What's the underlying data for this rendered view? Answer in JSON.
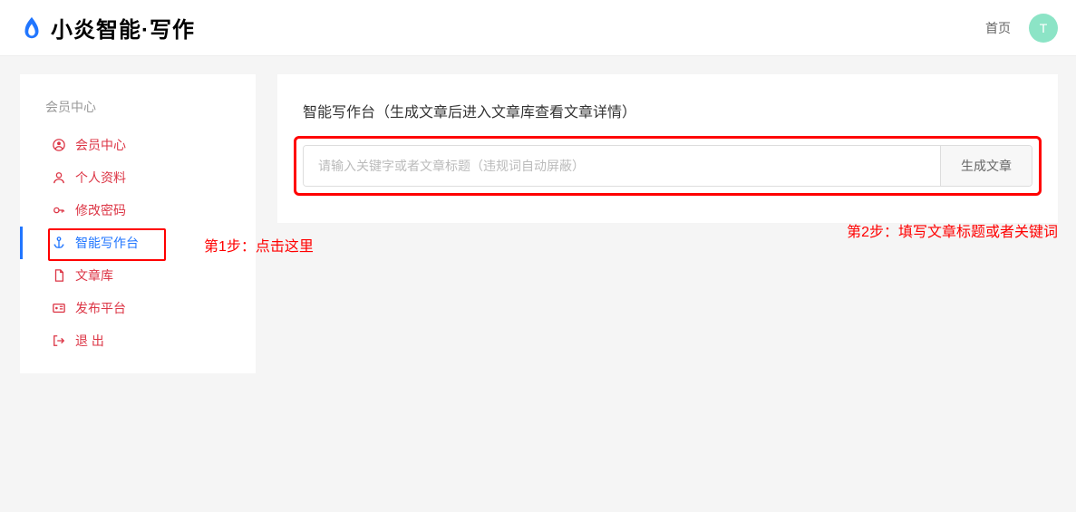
{
  "header": {
    "brand": "小炎智能·写作",
    "nav_home": "首页",
    "avatar_letter": "T"
  },
  "sidebar": {
    "title": "会员中心",
    "items": [
      {
        "label": "会员中心",
        "icon": "user-circle"
      },
      {
        "label": "个人资料",
        "icon": "user"
      },
      {
        "label": "修改密码",
        "icon": "key"
      },
      {
        "label": "智能写作台",
        "icon": "anchor",
        "active": true
      },
      {
        "label": "文章库",
        "icon": "file"
      },
      {
        "label": "发布平台",
        "icon": "id-card"
      },
      {
        "label": "退 出",
        "icon": "logout"
      }
    ]
  },
  "main": {
    "card_title": "智能写作台（生成文章后进入文章库查看文章详情）",
    "input_placeholder": "请输入关键字或者文章标题（违规词自动屏蔽）",
    "generate_label": "生成文章"
  },
  "annotations": {
    "step1": "第1步：点击这里",
    "step2": "第2步：填写文章标题或者关键词"
  }
}
